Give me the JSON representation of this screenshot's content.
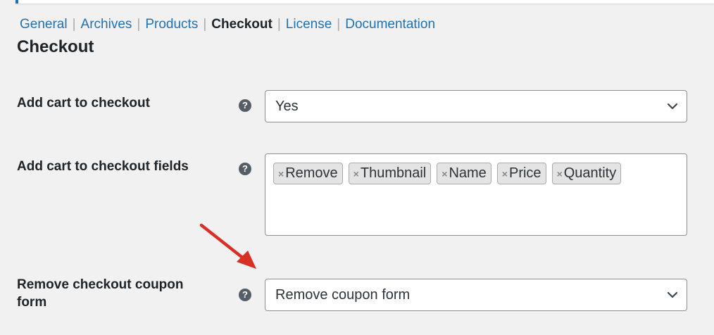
{
  "nav": {
    "tabs": [
      {
        "label": "General"
      },
      {
        "label": "Archives"
      },
      {
        "label": "Products"
      },
      {
        "label": "Checkout"
      },
      {
        "label": "License"
      },
      {
        "label": "Documentation"
      }
    ],
    "current": "Checkout",
    "separator": "|"
  },
  "section": {
    "title": "Checkout"
  },
  "fields": {
    "add_cart": {
      "label": "Add cart to checkout",
      "help_icon": "question-circle-icon",
      "value": "Yes"
    },
    "add_cart_fields": {
      "label": "Add cart to checkout fields",
      "help_icon": "question-circle-icon",
      "tags": [
        {
          "label": "Remove"
        },
        {
          "label": "Thumbnail"
        },
        {
          "label": "Name"
        },
        {
          "label": "Price"
        },
        {
          "label": "Quantity"
        }
      ],
      "remove_glyph": "×"
    },
    "remove_coupon": {
      "label_line1": "Remove checkout coupon",
      "label_line2": "form",
      "help_icon": "question-circle-icon",
      "value": "Remove coupon form"
    }
  },
  "annotation": {
    "arrow_color": "#d93025"
  },
  "colors": {
    "link": "#2271b1",
    "background": "#f1f1f1"
  }
}
